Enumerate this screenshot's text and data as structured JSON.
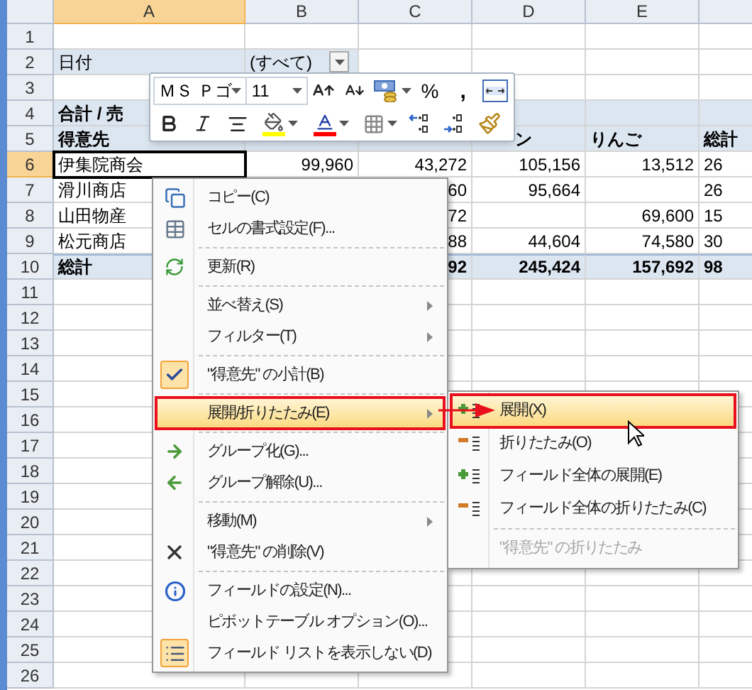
{
  "columns": [
    {
      "label": "A",
      "selected": true
    },
    {
      "label": "B",
      "selected": false
    },
    {
      "label": "C",
      "selected": false
    },
    {
      "label": "D",
      "selected": false
    },
    {
      "label": "E",
      "selected": false
    }
  ],
  "rows": [
    {
      "number": "1",
      "selected": false,
      "kind": "empty"
    },
    {
      "number": "2",
      "selected": false,
      "kind": "filter",
      "cells": {
        "A": "日付",
        "B": "(すべて)"
      }
    },
    {
      "number": "3",
      "selected": false,
      "kind": "empty"
    },
    {
      "number": "4",
      "selected": false,
      "kind": "header",
      "cells": {
        "A": "合計 / 売"
      }
    },
    {
      "number": "5",
      "selected": false,
      "kind": "header",
      "cells": {
        "A": "得意先",
        "D": "ン",
        "E": "りんご",
        "F": "総計"
      }
    },
    {
      "number": "6",
      "selected": true,
      "kind": "data",
      "cells": {
        "A": "伊集院商会",
        "B": "99,960",
        "C": "43,272",
        "D": "105,156",
        "E": "13,512",
        "F": "26"
      }
    },
    {
      "number": "7",
      "selected": false,
      "kind": "data",
      "cells": {
        "A": "滑川商店",
        "C": "60",
        "D": "95,664",
        "F": "26"
      }
    },
    {
      "number": "8",
      "selected": false,
      "kind": "data",
      "cells": {
        "A": "山田物産",
        "C": "72",
        "E": "69,600",
        "F": "15"
      }
    },
    {
      "number": "9",
      "selected": false,
      "kind": "data",
      "cells": {
        "A": "松元商店",
        "C": "88",
        "D": "44,604",
        "E": "74,580",
        "F": "30"
      }
    },
    {
      "number": "10",
      "selected": false,
      "kind": "total",
      "cells": {
        "A": "総計",
        "C": "92",
        "D": "245,424",
        "E": "157,692",
        "F": "98"
      }
    },
    {
      "number": "11",
      "selected": false,
      "kind": "empty"
    },
    {
      "number": "12",
      "selected": false,
      "kind": "empty"
    },
    {
      "number": "13",
      "selected": false,
      "kind": "empty"
    },
    {
      "number": "14",
      "selected": false,
      "kind": "empty"
    },
    {
      "number": "15",
      "selected": false,
      "kind": "empty"
    },
    {
      "number": "16",
      "selected": false,
      "kind": "empty"
    },
    {
      "number": "17",
      "selected": false,
      "kind": "empty"
    },
    {
      "number": "18",
      "selected": false,
      "kind": "empty"
    },
    {
      "number": "19",
      "selected": false,
      "kind": "empty"
    },
    {
      "number": "20",
      "selected": false,
      "kind": "empty"
    },
    {
      "number": "21",
      "selected": false,
      "kind": "empty"
    },
    {
      "number": "22",
      "selected": false,
      "kind": "empty"
    },
    {
      "number": "23",
      "selected": false,
      "kind": "empty"
    },
    {
      "number": "24",
      "selected": false,
      "kind": "empty"
    },
    {
      "number": "25",
      "selected": false,
      "kind": "empty"
    },
    {
      "number": "26",
      "selected": false,
      "kind": "empty"
    }
  ],
  "mini_toolbar": {
    "font": "ＭＳ Ｐゴ",
    "size": "11",
    "percent": "%",
    "comma": ","
  },
  "context_menu": {
    "groups": [
      [
        {
          "label": "コピー(C)",
          "selected": false,
          "checked": false,
          "submenu": false
        },
        {
          "label": "セルの書式設定(F)...",
          "selected": false,
          "checked": false,
          "submenu": false
        }
      ],
      [
        {
          "label": "更新(R)",
          "selected": false,
          "checked": false,
          "submenu": false
        }
      ],
      [
        {
          "label": "並べ替え(S)",
          "selected": false,
          "checked": false,
          "submenu": true
        },
        {
          "label": "フィルター(T)",
          "selected": false,
          "checked": false,
          "submenu": true
        }
      ],
      [
        {
          "label": "\"得意先\" の小計(B)",
          "selected": false,
          "checked": true,
          "submenu": false
        }
      ],
      [
        {
          "label": "展開/折りたたみ(E)",
          "selected": true,
          "checked": false,
          "submenu": true
        }
      ],
      [
        {
          "label": "グループ化(G)...",
          "selected": false,
          "checked": false,
          "submenu": false
        },
        {
          "label": "グループ解除(U)...",
          "selected": false,
          "checked": false,
          "submenu": false
        }
      ],
      [
        {
          "label": "移動(M)",
          "selected": false,
          "checked": false,
          "submenu": true
        },
        {
          "label": "\"得意先\" の削除(V)",
          "selected": false,
          "checked": false,
          "submenu": false
        }
      ],
      [
        {
          "label": "フィールドの設定(N)...",
          "selected": false,
          "checked": false,
          "submenu": false
        },
        {
          "label": "ピボットテーブル オプション(O)...",
          "selected": false,
          "checked": false,
          "submenu": false
        },
        {
          "label": "フィールド リストを表示しない(D)",
          "selected": false,
          "checked": true,
          "submenu": false
        }
      ]
    ]
  },
  "submenu": {
    "groups": [
      [
        {
          "label": "展開(X)",
          "selected": true,
          "disabled": false
        },
        {
          "label": "折りたたみ(O)",
          "selected": false,
          "disabled": false
        },
        {
          "label": "フィールド全体の展開(E)",
          "selected": false,
          "disabled": false
        },
        {
          "label": "フィールド全体の折りたたみ(C)",
          "selected": false,
          "disabled": false
        }
      ],
      [
        {
          "label": "\"得意先\" の折りたたみ",
          "selected": false,
          "disabled": true
        }
      ]
    ]
  }
}
